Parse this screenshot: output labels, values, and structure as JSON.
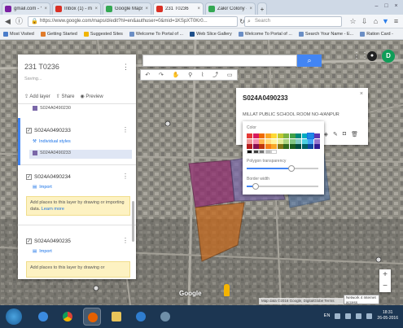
{
  "browser": {
    "tabs": [
      {
        "title": "gmail.com - Yaho...",
        "color": "#7b1fa2"
      },
      {
        "title": "Inbox (1) - mapma...",
        "color": "#d93025"
      },
      {
        "title": "Google Maps",
        "color": "#34a853"
      },
      {
        "title": "231 T0236",
        "color": "#d93025"
      },
      {
        "title": "Zakir Colony - Gu...",
        "color": "#34a853"
      }
    ],
    "url": "https://www.google.com/maps/d/edit?hl=en&authuser=0&mid=1KSpXT0Kr0...",
    "search_placeholder": "Search",
    "bookmarks": [
      "Most Visited",
      "Getting Started",
      "Suggested Sites",
      "Welcome To Portal of ...",
      "Web Slice Gallery",
      "Welcome To Portal of ...",
      "Search Your Name - E...",
      "Ration Card -"
    ]
  },
  "panel": {
    "title": "231 T0236",
    "subtitle": "Saving...",
    "actions": [
      "Add layer",
      "Share",
      "Preview"
    ],
    "top_item": "S024A0490230",
    "layers": [
      {
        "name": "S024A0490233",
        "style_link": "Individual styles",
        "item": "S024A0490233"
      },
      {
        "name": "S024A0490234",
        "import_link": "Import",
        "note": "Add places to this layer by drawing or importing data.",
        "learn_more": "Learn more"
      },
      {
        "name": "S024A0490235",
        "import_link": "Import",
        "note": "Add places to this layer by drawing or"
      }
    ]
  },
  "info": {
    "title": "S024A0490233",
    "body": "MILLAT PUBLIC SCHOOL ROOM NO-4/ANPUR"
  },
  "picker": {
    "color_label": "Color",
    "transparency_label": "Polygon transparency",
    "border_label": "Border width",
    "transparency_value": 0.62,
    "border_value": 0.12,
    "colors": [
      "#e53935",
      "#d81b60",
      "#ef6c00",
      "#f9a825",
      "#fdd835",
      "#c0ca33",
      "#7cb342",
      "#43a047",
      "#00897b",
      "#00acc1",
      "#1e88e5",
      "#5e35b1",
      "#ef9a9a",
      "#f48fb1",
      "#ffb74d",
      "#ffe082",
      "#fff59d",
      "#e6ee9c",
      "#aed581",
      "#81c784",
      "#80cbc4",
      "#4dd0e1",
      "#42a5f5",
      "#9575cd",
      "#b71c1c",
      "#880e4f",
      "#bf360c",
      "#f57f17",
      "#f9a825",
      "#827717",
      "#33691e",
      "#1b5e20",
      "#004d40",
      "#006064",
      "#0d47a1",
      "#311b92"
    ],
    "selected_index": 10,
    "grays": [
      "#000000",
      "#424242",
      "#757575",
      "#bdbdbd",
      "#ffffff"
    ]
  },
  "map": {
    "google_label": "Google",
    "attribution": "Map data ©2016 Google, DigitalGlobe  Terms",
    "network_tip": "Network 4 Internet access",
    "avatar_letter": "D"
  },
  "taskbar": {
    "lang": "EN",
    "time": "18:31",
    "date": "26-05-2016"
  }
}
